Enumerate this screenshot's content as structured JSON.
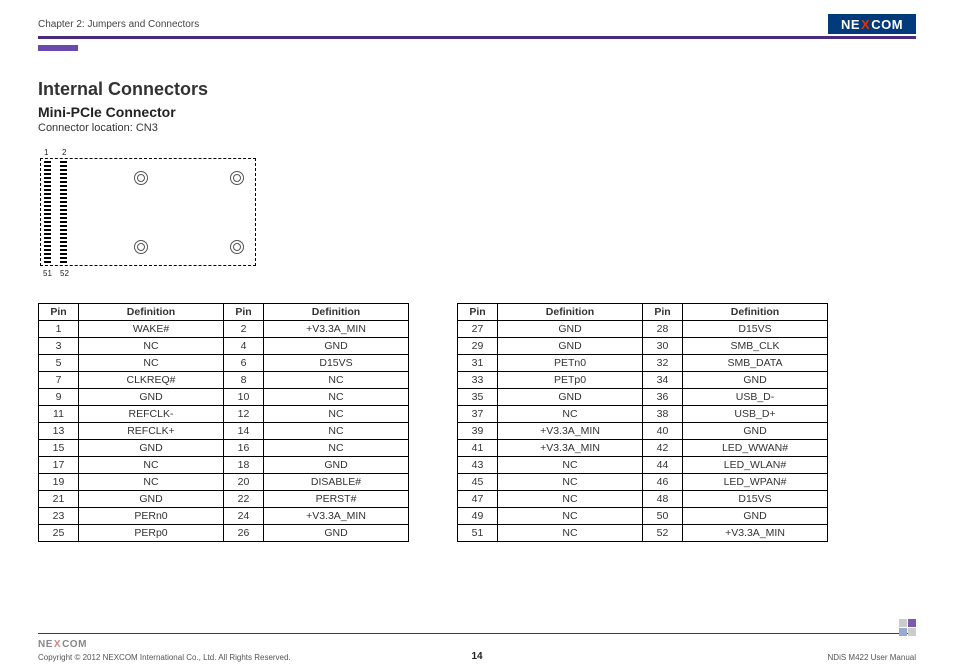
{
  "header": {
    "chapter": "Chapter 2: Jumpers and Connectors",
    "logo": "NEXCOM"
  },
  "title": "Internal Connectors",
  "subtitle": "Mini-PCIe Connector",
  "location": "Connector location: CN3",
  "diagram_labels": {
    "tl": "1",
    "tr": "2",
    "bl": "51",
    "br": "52"
  },
  "columns": {
    "pin": "Pin",
    "def": "Definition"
  },
  "table_left": [
    {
      "p1": "1",
      "d1": "WAKE#",
      "p2": "2",
      "d2": "+V3.3A_MIN"
    },
    {
      "p1": "3",
      "d1": "NC",
      "p2": "4",
      "d2": "GND"
    },
    {
      "p1": "5",
      "d1": "NC",
      "p2": "6",
      "d2": "D15VS"
    },
    {
      "p1": "7",
      "d1": "CLKREQ#",
      "p2": "8",
      "d2": "NC"
    },
    {
      "p1": "9",
      "d1": "GND",
      "p2": "10",
      "d2": "NC"
    },
    {
      "p1": "11",
      "d1": "REFCLK-",
      "p2": "12",
      "d2": "NC"
    },
    {
      "p1": "13",
      "d1": "REFCLK+",
      "p2": "14",
      "d2": "NC"
    },
    {
      "p1": "15",
      "d1": "GND",
      "p2": "16",
      "d2": "NC"
    },
    {
      "p1": "17",
      "d1": "NC",
      "p2": "18",
      "d2": "GND"
    },
    {
      "p1": "19",
      "d1": "NC",
      "p2": "20",
      "d2": "DISABLE#"
    },
    {
      "p1": "21",
      "d1": "GND",
      "p2": "22",
      "d2": "PERST#"
    },
    {
      "p1": "23",
      "d1": "PERn0",
      "p2": "24",
      "d2": "+V3.3A_MIN"
    },
    {
      "p1": "25",
      "d1": "PERp0",
      "p2": "26",
      "d2": "GND"
    }
  ],
  "table_right": [
    {
      "p1": "27",
      "d1": "GND",
      "p2": "28",
      "d2": "D15VS"
    },
    {
      "p1": "29",
      "d1": "GND",
      "p2": "30",
      "d2": "SMB_CLK"
    },
    {
      "p1": "31",
      "d1": "PETn0",
      "p2": "32",
      "d2": "SMB_DATA"
    },
    {
      "p1": "33",
      "d1": "PETp0",
      "p2": "34",
      "d2": "GND"
    },
    {
      "p1": "35",
      "d1": "GND",
      "p2": "36",
      "d2": "USB_D-"
    },
    {
      "p1": "37",
      "d1": "NC",
      "p2": "38",
      "d2": "USB_D+"
    },
    {
      "p1": "39",
      "d1": "+V3.3A_MIN",
      "p2": "40",
      "d2": "GND"
    },
    {
      "p1": "41",
      "d1": "+V3.3A_MIN",
      "p2": "42",
      "d2": "LED_WWAN#"
    },
    {
      "p1": "43",
      "d1": "NC",
      "p2": "44",
      "d2": "LED_WLAN#"
    },
    {
      "p1": "45",
      "d1": "NC",
      "p2": "46",
      "d2": "LED_WPAN#"
    },
    {
      "p1": "47",
      "d1": "NC",
      "p2": "48",
      "d2": "D15VS"
    },
    {
      "p1": "49",
      "d1": "NC",
      "p2": "50",
      "d2": "GND"
    },
    {
      "p1": "51",
      "d1": "NC",
      "p2": "52",
      "d2": "+V3.3A_MIN"
    }
  ],
  "footer": {
    "copyright": "Copyright © 2012 NEXCOM International Co., Ltd. All Rights Reserved.",
    "page": "14",
    "manual": "NDiS M422 User Manual"
  }
}
